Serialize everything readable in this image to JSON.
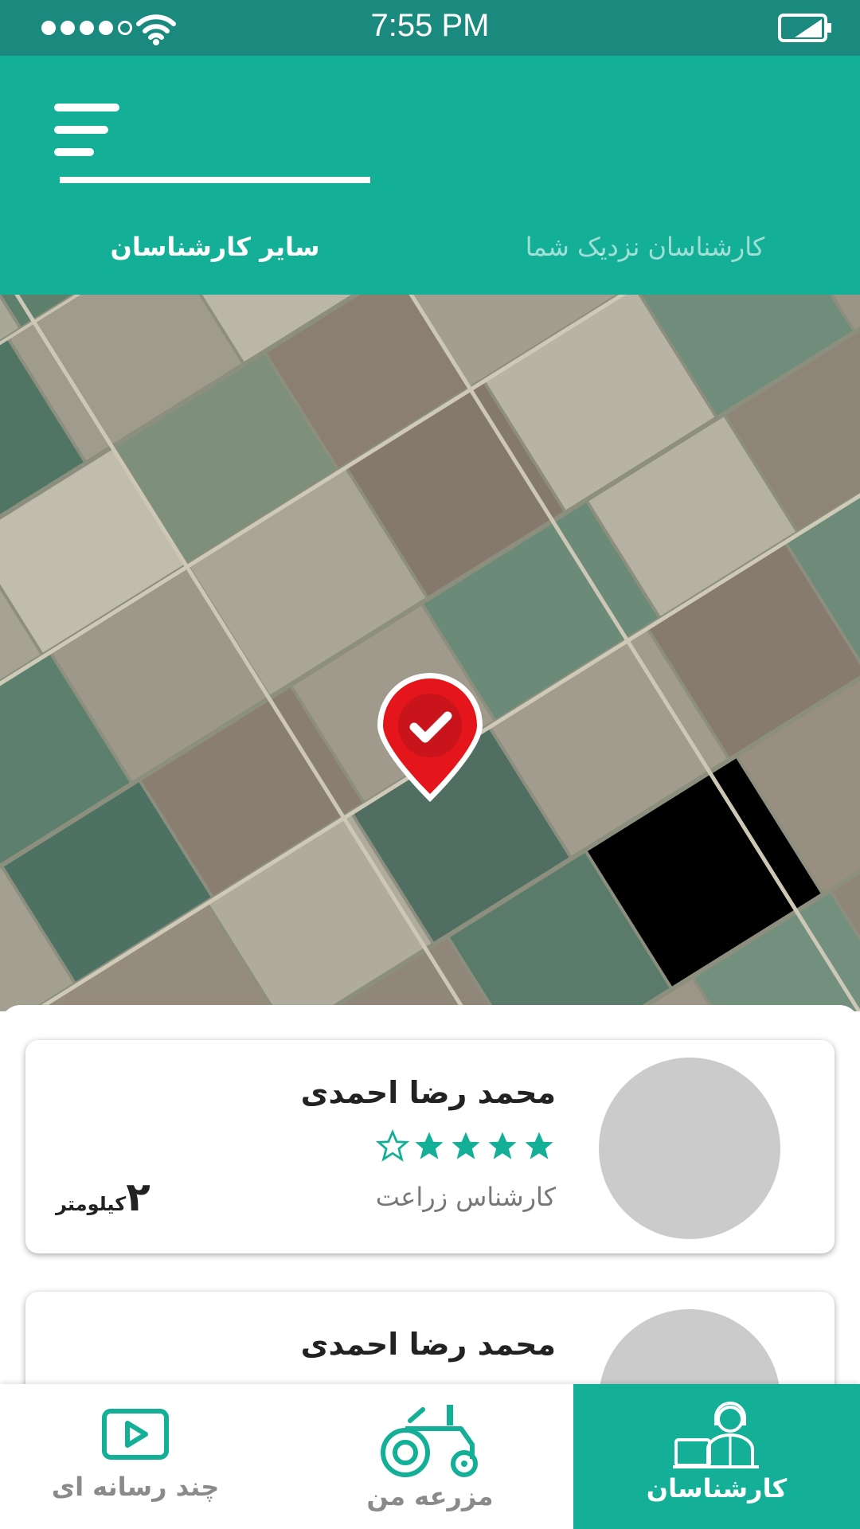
{
  "status_bar": {
    "time": "7:55 PM",
    "signal_icon": "signal-dots-icon",
    "wifi_icon": "wifi-icon",
    "battery_icon": "battery-icon"
  },
  "header": {
    "menu_icon": "menu-icon",
    "tabs": [
      {
        "label": "کارشناسان نزدیک شما",
        "active": false
      },
      {
        "label": "سایر کارشناسان",
        "active": true
      }
    ]
  },
  "map": {
    "pin_icon": "map-pin-check-icon"
  },
  "experts": [
    {
      "name": "محمد رضا احمدی",
      "rating": 4,
      "max_rating": 5,
      "role": "کارشناس زراعت",
      "distance_value": "۲",
      "distance_unit": "کیلومتر"
    },
    {
      "name": "محمد رضا احمدی"
    }
  ],
  "bottom_nav": [
    {
      "label": "چند رسانه ای",
      "icon": "play-video-icon",
      "active": false
    },
    {
      "label": "مزرعه من",
      "icon": "tractor-icon",
      "active": false
    },
    {
      "label": "کارشناسان",
      "icon": "expert-headset-icon",
      "active": true
    }
  ],
  "colors": {
    "status_bar": "#1a8a7e",
    "primary": "#13b097",
    "star": "#13b097",
    "avatar_placeholder": "#cbcbcb",
    "pin": "#e5161b"
  }
}
